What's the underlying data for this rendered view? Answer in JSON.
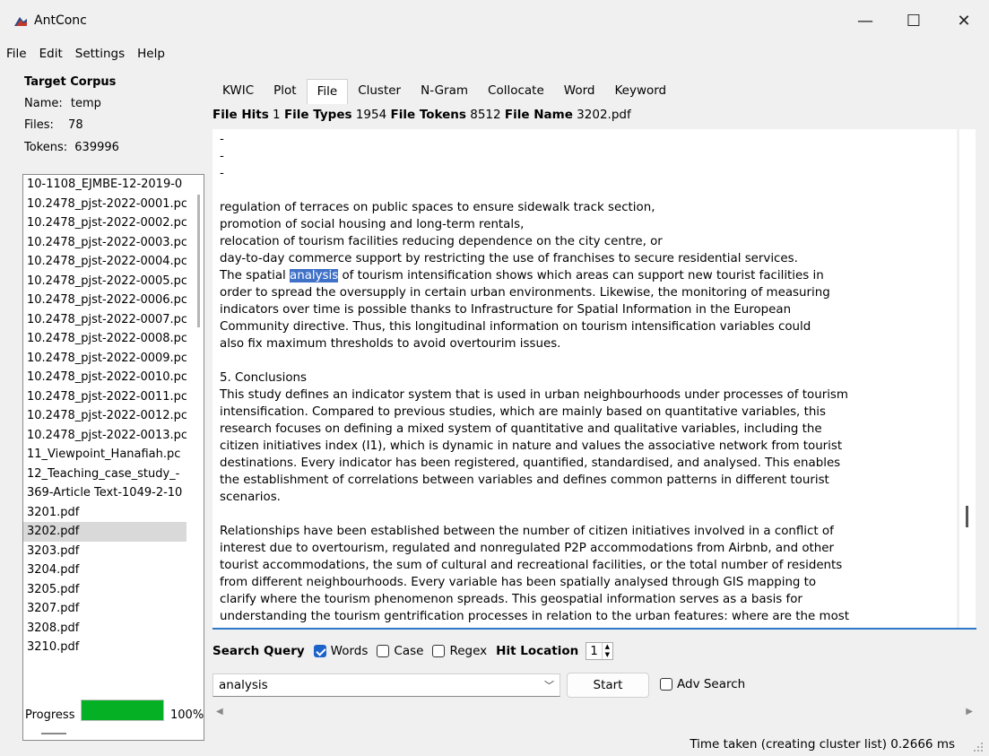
{
  "window": {
    "title": "AntConc",
    "controls": {
      "minimize": "—",
      "maximize": "☐",
      "close": "✕"
    }
  },
  "menu": [
    "File",
    "Edit",
    "Settings",
    "Help"
  ],
  "target_corpus": {
    "heading": "Target Corpus",
    "name_label": "Name:",
    "name_value": "temp",
    "files_label": "Files:",
    "files_value": "78",
    "tokens_label": "Tokens:",
    "tokens_value": "639996",
    "files": [
      "10-1108_EJMBE-12-2019-0",
      "10.2478_pjst-2022-0001.pc",
      "10.2478_pjst-2022-0002.pc",
      "10.2478_pjst-2022-0003.pc",
      "10.2478_pjst-2022-0004.pc",
      "10.2478_pjst-2022-0005.pc",
      "10.2478_pjst-2022-0006.pc",
      "10.2478_pjst-2022-0007.pc",
      "10.2478_pjst-2022-0008.pc",
      "10.2478_pjst-2022-0009.pc",
      "10.2478_pjst-2022-0010.pc",
      "10.2478_pjst-2022-0011.pc",
      "10.2478_pjst-2022-0012.pc",
      "10.2478_pjst-2022-0013.pc",
      "11_Viewpoint_Hanafiah.pc",
      "12_Teaching_case_study_-",
      "369-Article Text-1049-2-10",
      "3201.pdf",
      "3202.pdf",
      "3203.pdf",
      "3204.pdf",
      "3205.pdf",
      "3207.pdf",
      "3208.pdf",
      "3210.pdf"
    ],
    "selected_file": "3202.pdf"
  },
  "progress": {
    "label": "Progress",
    "value": "100%",
    "fraction": 1.0
  },
  "tabs": [
    "KWIC",
    "Plot",
    "File",
    "Cluster",
    "N-Gram",
    "Collocate",
    "Word",
    "Keyword"
  ],
  "active_tab": "File",
  "stats": {
    "hits_label": "File Hits",
    "hits_value": "1",
    "types_label": "File Types",
    "types_value": "1954",
    "tokens_label": "File Tokens",
    "tokens_value": "8512",
    "name_label": "File Name",
    "name_value": "3202.pdf"
  },
  "document": {
    "dash_lines": [
      "-",
      "-",
      "-"
    ],
    "para1": [
      "regulation of terraces on public spaces to ensure sidewalk track section,",
      "promotion of social housing and long-term rentals,",
      "relocation of tourism facilities reducing dependence on the city centre, or",
      "day-to-day commerce support by restricting the use of franchises to secure residential services."
    ],
    "hit_before": "The spatial ",
    "hit_word": "analysis",
    "hit_after": " of tourism intensification shows which areas can support new tourist facilities in",
    "para2_rest": [
      "order to spread the oversupply in certain urban environments. Likewise, the monitoring of measuring",
      "indicators over time is possible thanks to Infrastructure for Spatial Information in the European",
      "Community directive. Thus, this longitudinal information on tourism intensification variables could",
      "also fix maximum thresholds to avoid overtourim issues."
    ],
    "para3": [
      "5. Conclusions",
      "This study defines an indicator system that is used in urban neighbourhoods under processes of tourism",
      "intensification. Compared to previous studies, which are mainly based on quantitative variables, this",
      "research focuses on defining a mixed system of quantitative and qualitative variables, including the",
      "citizen initiatives index (I1), which is dynamic in nature and values the associative network from tourist",
      "destinations. Every indicator has been registered, quantified, standardised, and analysed. This enables",
      "the establishment of correlations between variables and defines common patterns in different tourist",
      "scenarios."
    ],
    "para4": [
      "Relationships have been established between the number of citizen initiatives involved in a conflict of",
      "interest due to overtourism, regulated and nonregulated P2P accommodations from Airbnb, and other",
      "tourist accommodations, the sum of cultural and recreational facilities, or the total number of residents",
      "from different neighbourhoods. Every variable has been spatially analysed through GIS mapping to",
      "clarify where the tourism phenomenon spreads. This geospatial information serves as a basis for",
      "understanding the tourism gentrification processes in relation to the urban features: where are the most"
    ]
  },
  "search": {
    "query_label": "Search Query",
    "words_label": "Words",
    "words_checked": true,
    "case_label": "Case",
    "case_checked": false,
    "regex_label": "Regex",
    "regex_checked": false,
    "hit_location_label": "Hit Location",
    "hit_location_value": "1",
    "query_value": "analysis",
    "start_label": "Start",
    "adv_search_label": "Adv Search",
    "adv_search_checked": false
  },
  "status": {
    "text": "Time taken (creating cluster list) 0.2666 ms"
  }
}
